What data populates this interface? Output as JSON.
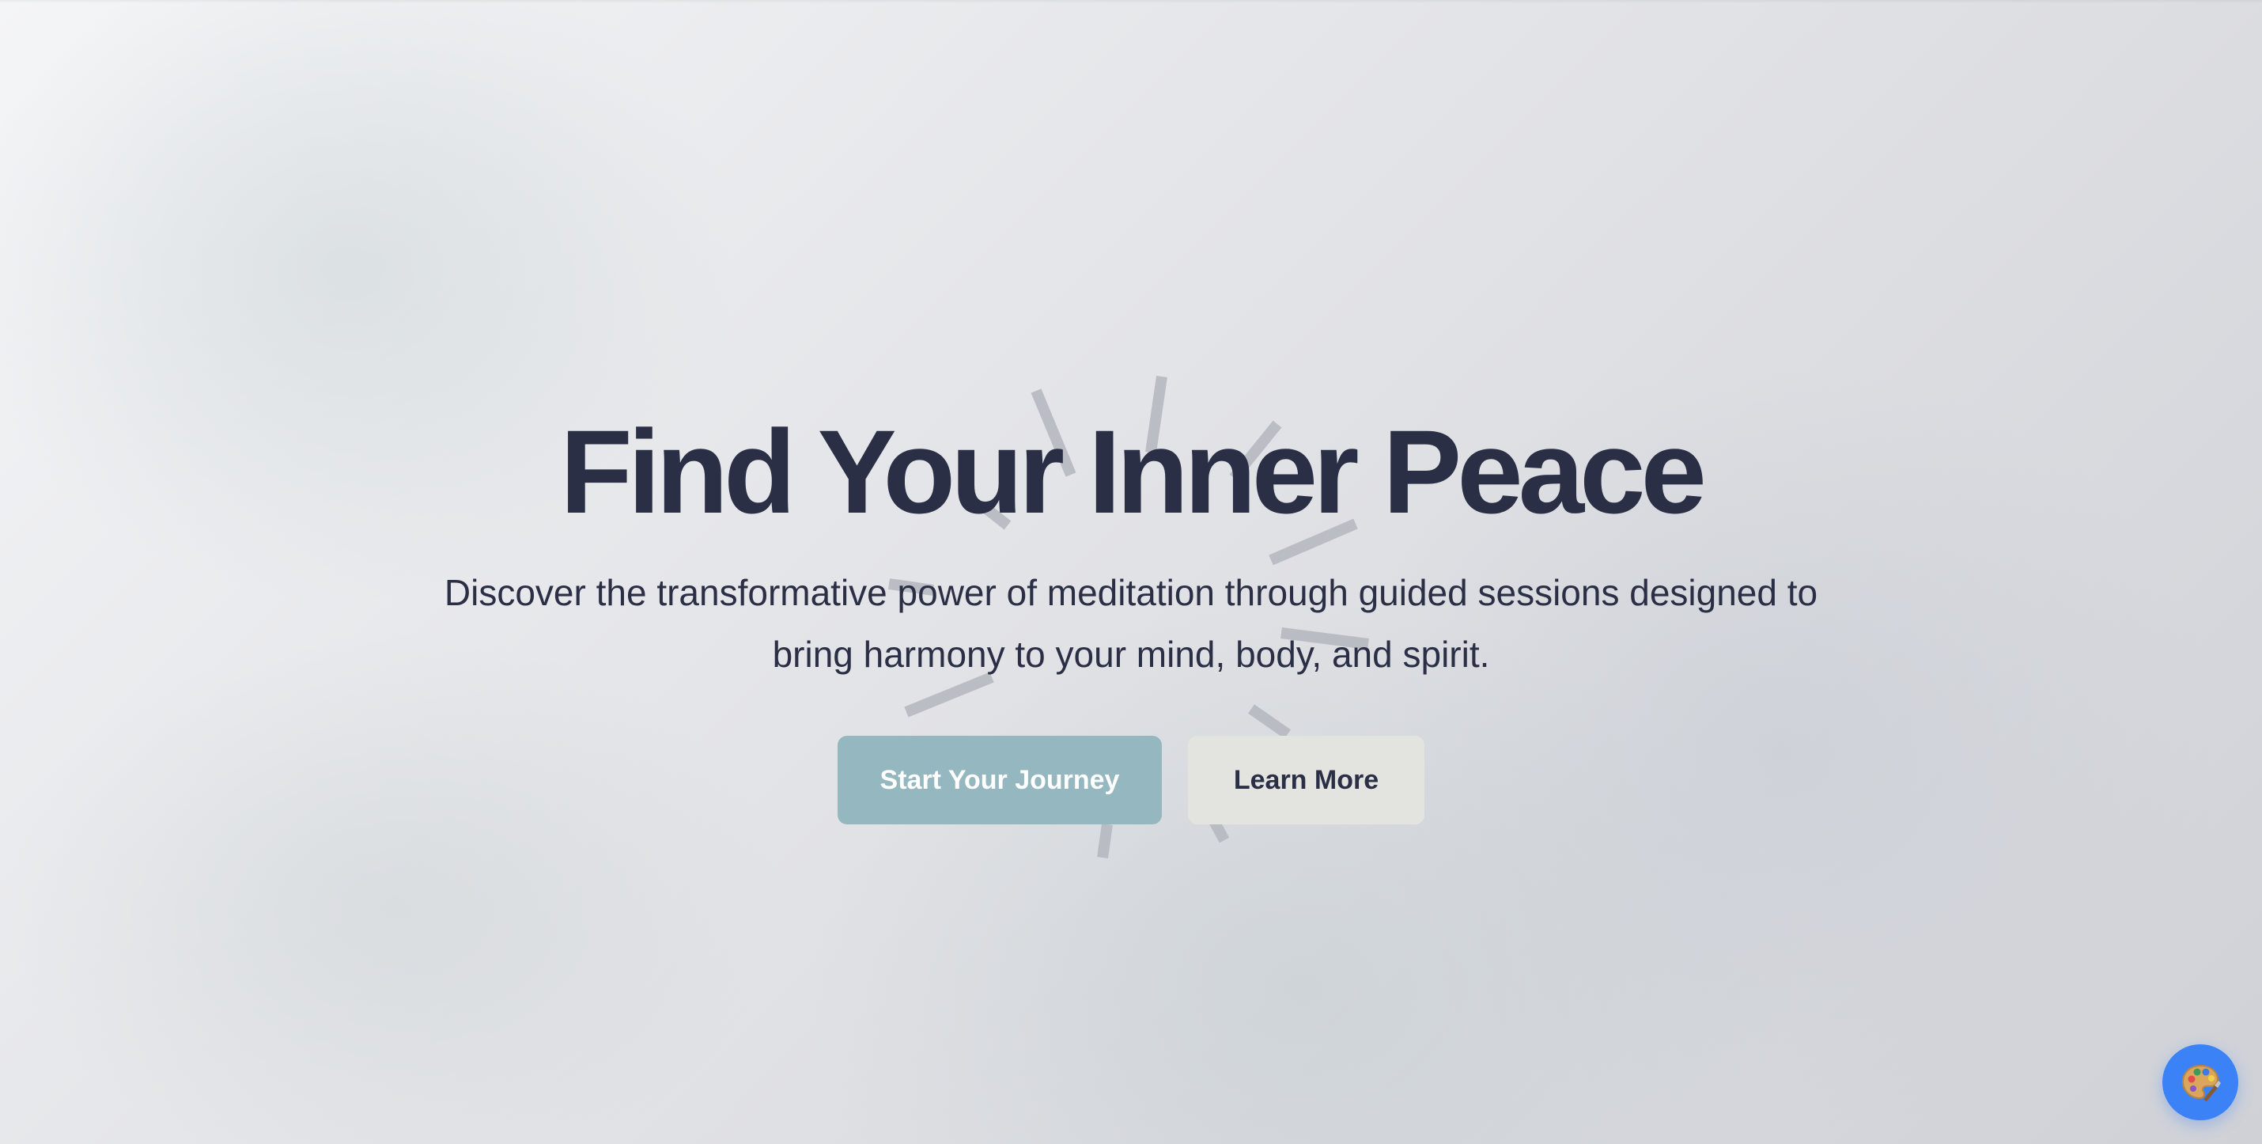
{
  "hero": {
    "title": "Find Your Inner Peace",
    "subtitle": "Discover the transformative power of meditation through guided sessions designed to bring harmony to your mind, body, and spirit.",
    "primary_button": "Start Your Journey",
    "secondary_button": "Learn More"
  },
  "floating_action": {
    "icon": "palette-icon"
  },
  "colors": {
    "text": "#2a2f45",
    "primary_button_bg": "#95b7bf",
    "secondary_button_bg": "#e3e4e0",
    "fab_bg": "#3b82f6",
    "sunburst_rays": "#b4b7bf"
  }
}
